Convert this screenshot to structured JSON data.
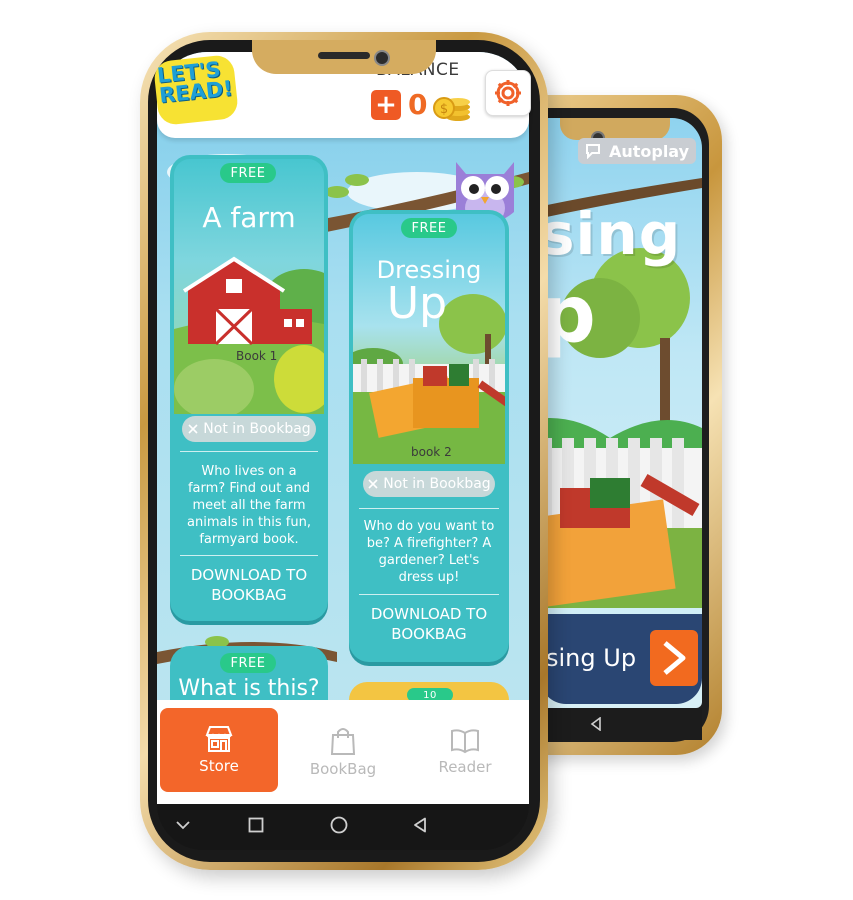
{
  "back_screen": {
    "autoplay_label": "Autoplay",
    "title_line1": "sing",
    "title_line2": "p",
    "cta_text": "sing Up",
    "nav_back_icon": "triangle-back-icon"
  },
  "header": {
    "logo_line1": "LET'S",
    "logo_line2": "READ!",
    "balance_label": "BALANCE",
    "add_label": "+",
    "balance_value": "0",
    "settings_icon": "gear-icon"
  },
  "books": [
    {
      "badge": "FREE",
      "title": "A farm",
      "cover_label": "Book 1",
      "bookbag_status": "Not in Bookbag",
      "description": "Who lives on a farm? Find out and meet all the farm animals in this fun, farmyard book.",
      "download_label": "DOWNLOAD TO BOOKBAG"
    },
    {
      "badge": "FREE",
      "title_line1": "Dressing",
      "title_line2": "Up",
      "cover_label": "book 2",
      "bookbag_status": "Not in Bookbag",
      "description": "Who do you want to be? A firefighter? A gardener? Let's dress up!",
      "download_label": "DOWNLOAD TO BOOKBAG"
    },
    {
      "badge": "FREE",
      "title": "What is this?"
    },
    {
      "badge": "10"
    }
  ],
  "tabs": [
    {
      "label": "Store",
      "icon": "store-icon",
      "active": true
    },
    {
      "label": "BookBag",
      "icon": "bag-icon",
      "active": false
    },
    {
      "label": "Reader",
      "icon": "book-icon",
      "active": false
    }
  ],
  "colors": {
    "accent_orange": "#f3662a",
    "card_teal": "#3fbfc4",
    "badge_green": "#29c98a",
    "gold": "#c99941"
  }
}
